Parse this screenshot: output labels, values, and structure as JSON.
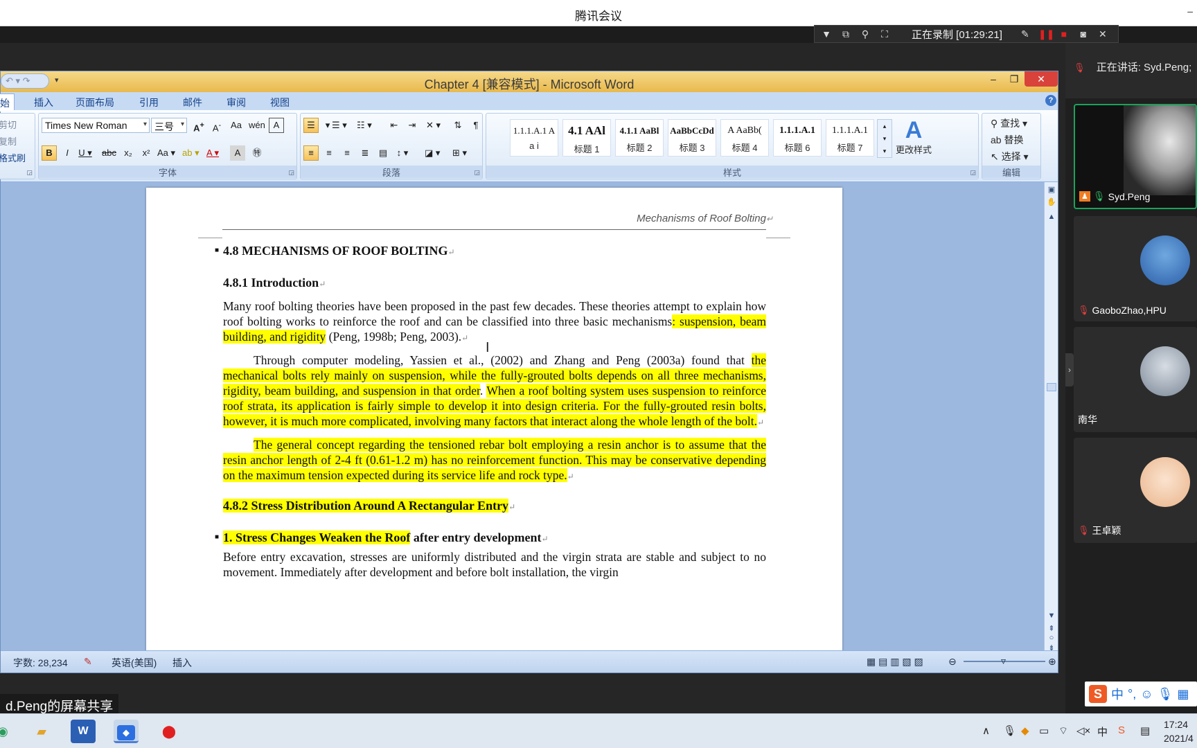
{
  "meeting": {
    "app_title": "腾讯会议",
    "recording_text": "正在录制 [01:29:21]",
    "share_label": "d.Peng的屏幕共享",
    "speaking_text": "正在讲话: Syd.Peng;",
    "participants": [
      {
        "name": "Syd.Peng",
        "muted": false,
        "video": true
      },
      {
        "name": "GaoboZhao,HPU",
        "muted": true,
        "video": false
      },
      {
        "name": "南华",
        "muted": false,
        "video": false
      },
      {
        "name": "王卓颖",
        "muted": true,
        "video": false
      }
    ]
  },
  "word": {
    "title": "Chapter 4 [兼容模式] - Microsoft Word",
    "tabs": [
      "始",
      "插入",
      "页面布局",
      "引用",
      "邮件",
      "审阅",
      "视图"
    ],
    "clipboard": [
      "剪切",
      "复制",
      "格式刷"
    ],
    "font_name": "Times New Roman",
    "font_size": "三号",
    "group_labels": {
      "font": "字体",
      "paragraph": "段落",
      "styles": "样式",
      "editing": "编辑"
    },
    "styles": [
      {
        "sample": "1.1.1.A.1 A",
        "name": "a i"
      },
      {
        "sample": "4.1 AAl",
        "name": "标题 1"
      },
      {
        "sample": "4.1.1 AaBl",
        "name": "标题 2"
      },
      {
        "sample": "AaBbCcDd",
        "name": "标题 3"
      },
      {
        "sample": "A AaBb(",
        "name": "标题 4"
      },
      {
        "sample": "1.1.1.A.1",
        "name": "标题 6"
      },
      {
        "sample": "1.1.1.A.1",
        "name": "标题 7"
      }
    ],
    "change_styles": "更改样式",
    "editing": {
      "find": "查找",
      "replace": "替换",
      "select": "选择"
    },
    "status": {
      "word_count": "字数: 28,234",
      "language": "英语(美国)",
      "mode": "插入"
    }
  },
  "document": {
    "page_header": "Mechanisms of Roof Bolting",
    "heading_48": "4.8   MECHANISMS  OF ROOF  BOLTING",
    "heading_481": "4.8.1   Introduction",
    "p1_a": "Many roof bolting theories have been proposed in the past few decades. These theories attempt to explain how roof bolting works to reinforce the roof and can be classified into three basic mechanisms",
    "p1_hl": ": suspension, beam building, and rigidity",
    "p1_b": " (Peng, 1998b; Peng, 2003).",
    "p2_a": "Through computer modeling, Yassien et al., (2002) and Zhang and Peng (2003a) found that ",
    "p2_hl1": "the mechanical bolts rely mainly on suspension, while the fully-grouted bolts depends on all three mechanisms, rigidity, beam building, and suspension in that order",
    "p2_b": ". ",
    "p2_hl2": "When a roof bolting system uses suspension to reinforce roof strata, its application is fairly simple to develop it into design criteria. For the fully-grouted resin bolts, however, it is much more complicated, involving many factors that interact along the whole length of the bolt.",
    "p3_hl": "The general concept regarding the tensioned rebar bolt employing a resin anchor is to assume that the resin anchor length of 2-4 ft (0.61-1.2 m) has no reinforcement function. This may be conservative depending on the maximum tension expected during its service life and rock type.",
    "heading_482": "4.8.2    Stress Distribution Around A Rectangular Entry",
    "heading_1_hl": "1. Stress Changes Weaken the Roof",
    "heading_1_rest": " after entry development",
    "p4": "Before entry excavation, stresses are uniformly distributed and the virgin strata are stable and subject to no movement. Immediately after development and before bolt installation, the virgin"
  },
  "taskbar": {
    "time": "17:24",
    "date": "2021/4"
  }
}
